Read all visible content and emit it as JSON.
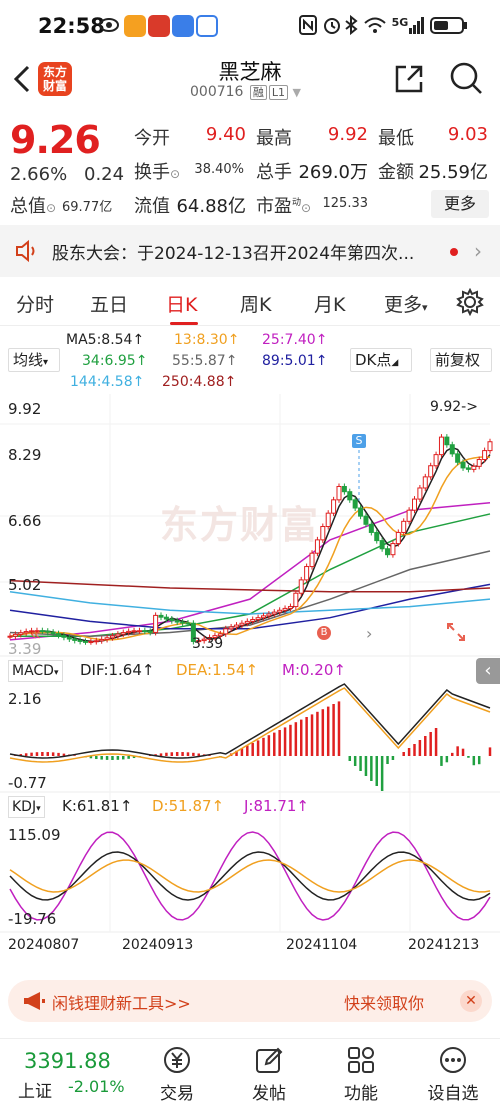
{
  "status_bar": {
    "time": "22:58",
    "network": "5G",
    "battery": "41",
    "signal_badge": "6"
  },
  "header": {
    "back_icon": "chevron-left-icon",
    "logo_text_1": "东方",
    "logo_text_2": "财富",
    "stock_name": "黑芝麻",
    "stock_code": "000716",
    "tag_margin": "融",
    "tag_level": "L1"
  },
  "quote": {
    "price": "9.26",
    "change_pct": "2.66%",
    "change": "0.24",
    "open_label": "今开",
    "open": "9.40",
    "high_label": "最高",
    "high": "9.92",
    "low_label": "最低",
    "low": "9.03",
    "turnover_label": "换手",
    "turnover": "38.40%",
    "volume_label": "总手",
    "volume": "269.0万",
    "amount_label": "金额",
    "amount": "25.59亿",
    "total_cap_label": "总值",
    "total_cap": "69.77亿",
    "float_cap_label": "流值",
    "float_cap": "64.88亿",
    "pe_label": "市盈",
    "pe_sup": "动",
    "pe": "125.33",
    "more_label": "更多"
  },
  "notice": {
    "text": "股东大会：于2024-12-13召开2024年第四次..."
  },
  "tabs": [
    {
      "label": "分时"
    },
    {
      "label": "五日"
    },
    {
      "label": "日K"
    },
    {
      "label": "周K"
    },
    {
      "label": "月K"
    },
    {
      "label": "更多"
    }
  ],
  "ma_bar": {
    "selector": "均线",
    "dk_label": "DK点",
    "adjust_label": "前复权",
    "ma": [
      {
        "text": "MA5:8.54↑",
        "color": "#222222"
      },
      {
        "text": "13:8.30↑",
        "color": "#f0a020"
      },
      {
        "text": "25:7.40↑",
        "color": "#c020c0"
      },
      {
        "text": "34:6.95↑",
        "color": "#20a040"
      },
      {
        "text": "55:5.87↑",
        "color": "#666666"
      },
      {
        "text": "89:5.01↑",
        "color": "#2020a0"
      },
      {
        "text": "144:4.58↑",
        "color": "#40b0e0"
      },
      {
        "text": "250:4.88↑",
        "color": "#a02020"
      }
    ]
  },
  "chart": {
    "y_labels": [
      "9.92",
      "8.29",
      "6.66",
      "5.02",
      "3.39"
    ],
    "high_marker": "9.92->",
    "low_marker": "3.39",
    "macd_label": "MACD",
    "dif": "DIF:1.64↑",
    "dea": "DEA:1.54↑",
    "m": "M:0.20↑",
    "macd_top": "2.16",
    "macd_bottom": "-0.77",
    "kdj_label": "KDJ",
    "k": "K:61.81↑",
    "d": "D:51.87↑",
    "j": "J:81.71↑",
    "kdj_top": "115.09",
    "kdj_bottom": "-19.76",
    "dates": [
      "20240807",
      "20240913",
      "20241104",
      "20241213"
    ],
    "watermark": "东方财富",
    "s_marker": "S",
    "b_marker": "B"
  },
  "chart_data": {
    "type": "candlestick",
    "ylim": [
      3.39,
      9.92
    ],
    "x_dates": [
      "20240807",
      "20240913",
      "20241104",
      "20241213"
    ],
    "last_close": 9.26,
    "high": 9.92,
    "low": 3.39,
    "ma": {
      "MA5": 8.54,
      "MA13": 8.3,
      "MA25": 7.4,
      "MA34": 6.95,
      "MA55": 5.87,
      "MA89": 5.01,
      "MA144": 4.58,
      "MA250": 4.88
    },
    "macd": {
      "DIF": 1.64,
      "DEA": 1.54,
      "M": 0.2,
      "range": [
        -0.77,
        2.16
      ]
    },
    "kdj": {
      "K": 61.81,
      "D": 51.87,
      "J": 81.71,
      "range": [
        -19.76,
        115.09
      ]
    }
  },
  "promo": {
    "left": "闲钱理财新工具>>",
    "right": "快来领取你"
  },
  "bottom_bar": {
    "index_value": "3391.88",
    "index_name": "上证",
    "index_change": "-2.01%",
    "items": [
      {
        "label": "交易",
        "icon": "yen-circle-icon"
      },
      {
        "label": "发帖",
        "icon": "edit-icon"
      },
      {
        "label": "功能",
        "icon": "grid-icon"
      },
      {
        "label": "设自选",
        "icon": "more-circle-icon"
      }
    ]
  }
}
